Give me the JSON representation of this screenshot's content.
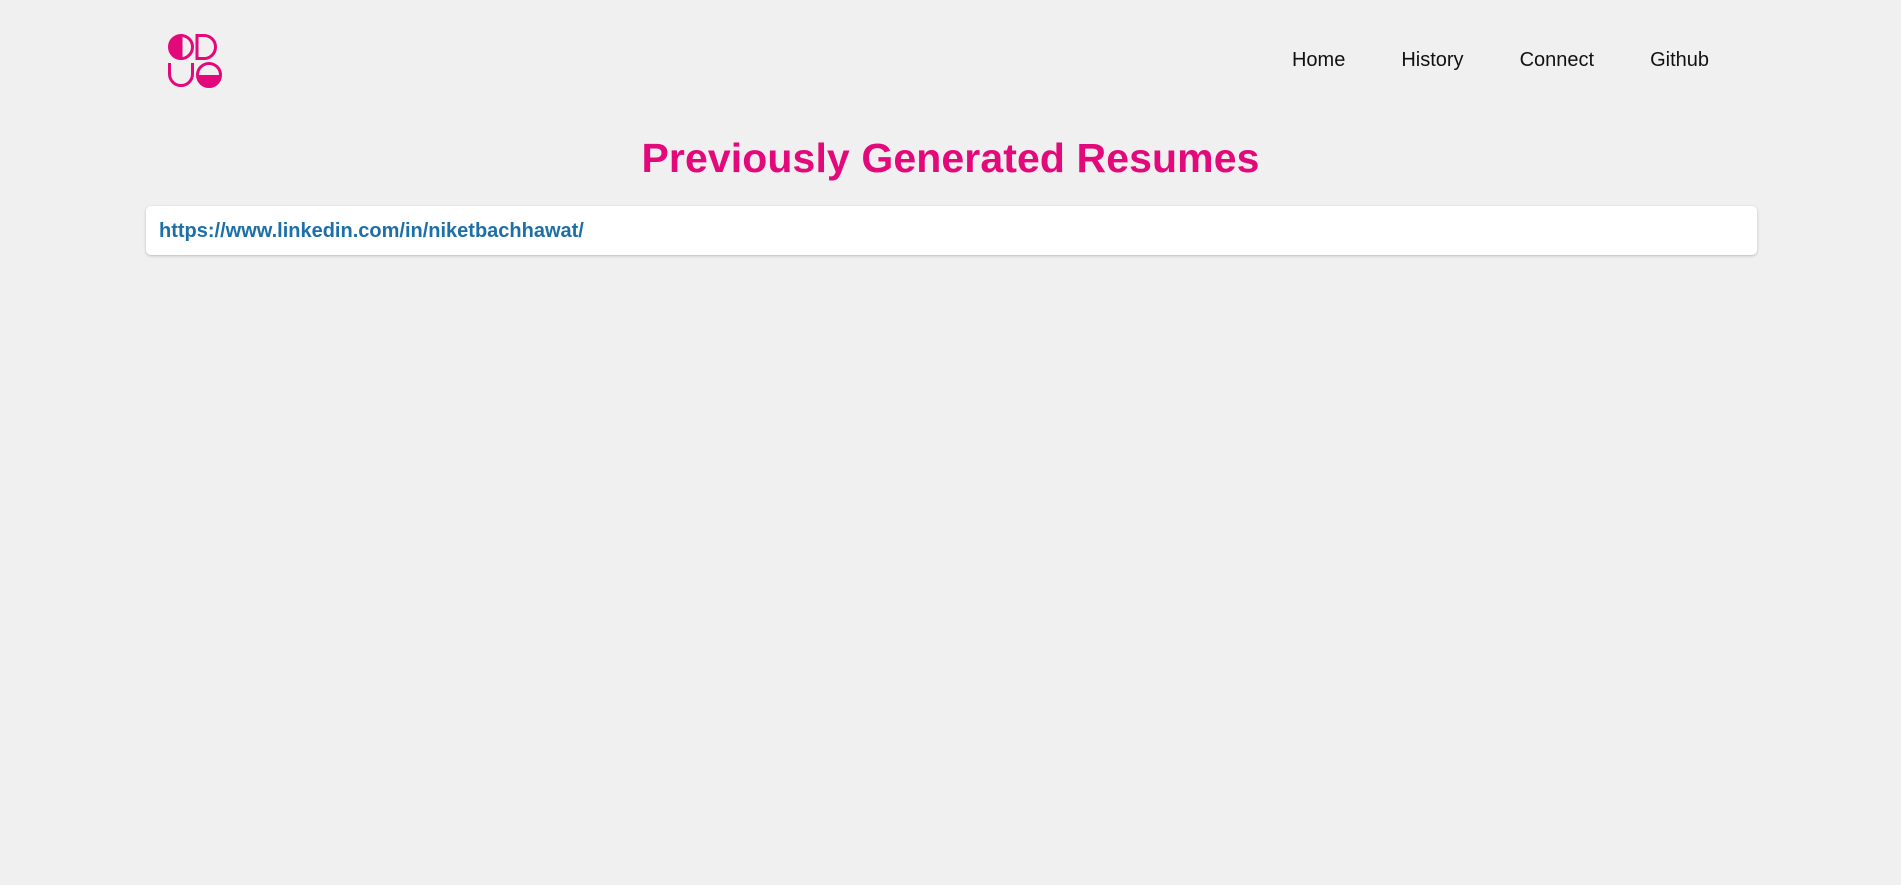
{
  "brand": {
    "logo_icon": "pink-geometric-resume-logo-icon",
    "accent_color": "#e3097a"
  },
  "nav": {
    "items": [
      {
        "label": "Home"
      },
      {
        "label": "History"
      },
      {
        "label": "Connect"
      },
      {
        "label": "Github"
      }
    ]
  },
  "main": {
    "title": "Previously Generated Resumes",
    "history_items": [
      {
        "url": "https://www.linkedin.com/in/niketbachhawat/"
      }
    ]
  },
  "colors": {
    "background": "#f0f0f0",
    "card": "#ffffff",
    "link": "#1d6fa8",
    "nav_text": "#111111"
  }
}
